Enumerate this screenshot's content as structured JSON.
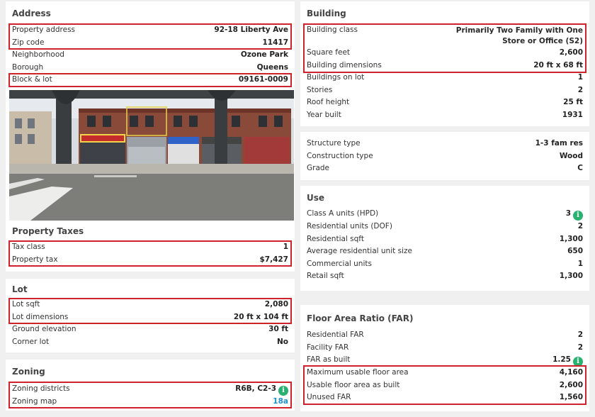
{
  "address": {
    "title": "Address",
    "property_address_label": "Property address",
    "property_address": "92-18 Liberty Ave",
    "zip_label": "Zip code",
    "zip": "11417",
    "neighborhood_label": "Neighborhood",
    "neighborhood": "Ozone Park",
    "borough_label": "Borough",
    "borough": "Queens",
    "block_lot_label": "Block & lot",
    "block_lot": "09161-0009"
  },
  "taxes": {
    "title": "Property Taxes",
    "tax_class_label": "Tax class",
    "tax_class": "1",
    "property_tax_label": "Property tax",
    "property_tax": "$7,427"
  },
  "lot": {
    "title": "Lot",
    "lot_sqft_label": "Lot sqft",
    "lot_sqft": "2,080",
    "lot_dimensions_label": "Lot dimensions",
    "lot_dimensions": "20 ft x 104 ft",
    "ground_elevation_label": "Ground elevation",
    "ground_elevation": "30 ft",
    "corner_lot_label": "Corner lot",
    "corner_lot": "No"
  },
  "zoning": {
    "title": "Zoning",
    "districts_label": "Zoning districts",
    "districts": "R6B, C2-3",
    "map_label": "Zoning map",
    "map": "18a"
  },
  "building": {
    "title": "Building",
    "class_label": "Building class",
    "class": "Primarily Two Family with One Store or Office (S2)",
    "square_feet_label": "Square feet",
    "square_feet": "2,600",
    "dimensions_label": "Building dimensions",
    "dimensions": "20 ft x 68 ft",
    "buildings_on_lot_label": "Buildings on lot",
    "buildings_on_lot": "1",
    "stories_label": "Stories",
    "stories": "2",
    "roof_height_label": "Roof height",
    "roof_height": "25 ft",
    "year_built_label": "Year built",
    "year_built": "1931"
  },
  "structure": {
    "type_label": "Structure type",
    "type": "1-3 fam res",
    "construction_label": "Construction type",
    "construction": "Wood",
    "grade_label": "Grade",
    "grade": "C"
  },
  "use": {
    "title": "Use",
    "class_a_label": "Class A units (HPD)",
    "class_a": "3",
    "res_units_label": "Residential units (DOF)",
    "res_units": "2",
    "res_sqft_label": "Residential sqft",
    "res_sqft": "1,300",
    "avg_unit_label": "Average residential unit size",
    "avg_unit": "650",
    "commercial_label": "Commercial units",
    "commercial": "1",
    "retail_label": "Retail sqft",
    "retail": "1,300"
  },
  "far": {
    "title": "Floor Area Ratio (FAR)",
    "res_far_label": "Residential FAR",
    "res_far": "2",
    "facility_far_label": "Facility FAR",
    "facility_far": "2",
    "as_built_label": "FAR as built",
    "as_built": "1.25",
    "max_floor_label": "Maximum usable floor area",
    "max_floor": "4,160",
    "usable_built_label": "Usable floor area as built",
    "usable_built": "2,600",
    "unused_label": "Unused FAR",
    "unused": "1,560"
  },
  "info_icon_glyph": "i",
  "colors": {
    "highlight": "#d0222d",
    "info": "#27b26f",
    "link": "#1f8fcf"
  }
}
